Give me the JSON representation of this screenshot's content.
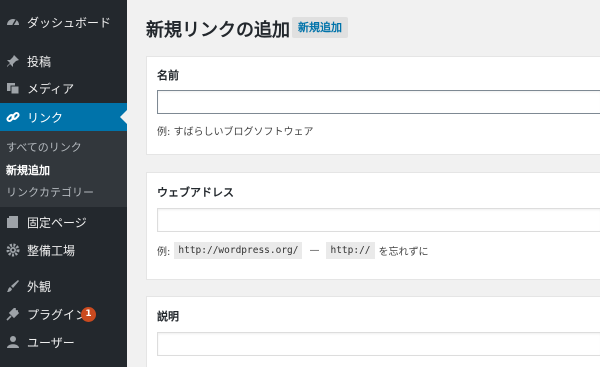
{
  "sidebar": {
    "items": [
      {
        "label": "ダッシュボード",
        "icon": "dashboard-icon"
      },
      {
        "label": "投稿",
        "icon": "pin-icon"
      },
      {
        "label": "メディア",
        "icon": "media-icon"
      },
      {
        "label": "リンク",
        "icon": "link-icon",
        "active": true
      },
      {
        "label": "固定ページ",
        "icon": "page-icon"
      },
      {
        "label": "整備工場",
        "icon": "gear-icon"
      },
      {
        "label": "外観",
        "icon": "brush-icon"
      },
      {
        "label": "プラグイン",
        "icon": "plugin-icon",
        "badge": "1"
      },
      {
        "label": "ユーザー",
        "icon": "user-icon"
      }
    ],
    "submenu": [
      {
        "label": "すべてのリンク"
      },
      {
        "label": "新規追加",
        "current": true
      },
      {
        "label": "リンクカテゴリー"
      }
    ]
  },
  "header": {
    "title": "新規リンクの追加",
    "add_new_label": "新規追加"
  },
  "form": {
    "name": {
      "title": "名前",
      "value": "",
      "hint": "例: すばらしいブログソフトウェア"
    },
    "web_address": {
      "title": "ウェブアドレス",
      "value": "",
      "hint_prefix": "例:",
      "hint_code1": "http://wordpress.org/",
      "hint_sep": "—",
      "hint_code2": "http://",
      "hint_suffix": "を忘れずに"
    },
    "description": {
      "title": "説明",
      "value": ""
    }
  },
  "colors": {
    "sidebar_bg": "#23282d",
    "active_bg": "#0073aa",
    "badge": "#ca4a1f"
  }
}
